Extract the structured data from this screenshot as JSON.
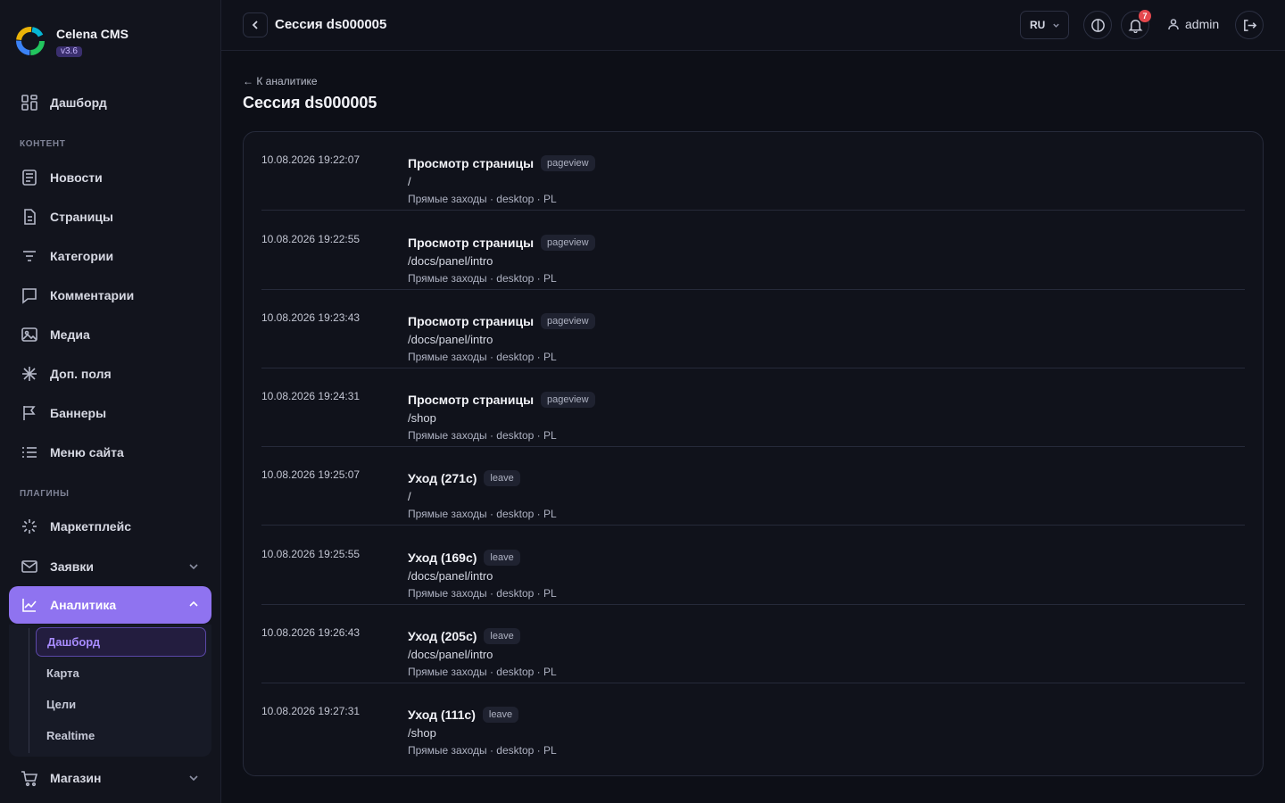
{
  "brand": {
    "name": "Celena CMS",
    "version": "v3.6"
  },
  "sidebar": {
    "dashboard": "Дашборд",
    "sections": {
      "content": "КОНТЕНТ",
      "plugins": "ПЛАГИНЫ"
    },
    "content_items": [
      "Новости",
      "Страницы",
      "Категории",
      "Комментарии",
      "Медиа",
      "Доп. поля",
      "Баннеры",
      "Меню сайта"
    ],
    "plugin_items": {
      "marketplace": "Маркетплейс",
      "requests": "Заявки",
      "analytics": "Аналитика",
      "shop": "Магазин"
    },
    "analytics_sub": [
      "Дашборд",
      "Карта",
      "Цели",
      "Realtime"
    ]
  },
  "topbar": {
    "title": "Сессия ds000005",
    "language": "RU",
    "notifications_count": "7",
    "user": "admin"
  },
  "main": {
    "breadcrumb": "← К аналитике",
    "title": "Сессия ds000005",
    "events": [
      {
        "time": "10.08.2026 19:22:07",
        "title": "Просмотр страницы",
        "tag": "pageview",
        "path": "/",
        "meta": "Прямые заходы · desktop · PL"
      },
      {
        "time": "10.08.2026 19:22:55",
        "title": "Просмотр страницы",
        "tag": "pageview",
        "path": "/docs/panel/intro",
        "meta": "Прямые заходы · desktop · PL"
      },
      {
        "time": "10.08.2026 19:23:43",
        "title": "Просмотр страницы",
        "tag": "pageview",
        "path": "/docs/panel/intro",
        "meta": "Прямые заходы · desktop · PL"
      },
      {
        "time": "10.08.2026 19:24:31",
        "title": "Просмотр страницы",
        "tag": "pageview",
        "path": "/shop",
        "meta": "Прямые заходы · desktop · PL"
      },
      {
        "time": "10.08.2026 19:25:07",
        "title": "Уход (271с)",
        "tag": "leave",
        "path": "/",
        "meta": "Прямые заходы · desktop · PL"
      },
      {
        "time": "10.08.2026 19:25:55",
        "title": "Уход (169с)",
        "tag": "leave",
        "path": "/docs/panel/intro",
        "meta": "Прямые заходы · desktop · PL"
      },
      {
        "time": "10.08.2026 19:26:43",
        "title": "Уход (205с)",
        "tag": "leave",
        "path": "/docs/panel/intro",
        "meta": "Прямые заходы · desktop · PL"
      },
      {
        "time": "10.08.2026 19:27:31",
        "title": "Уход (111с)",
        "tag": "leave",
        "path": "/shop",
        "meta": "Прямые заходы · desktop · PL"
      }
    ]
  }
}
